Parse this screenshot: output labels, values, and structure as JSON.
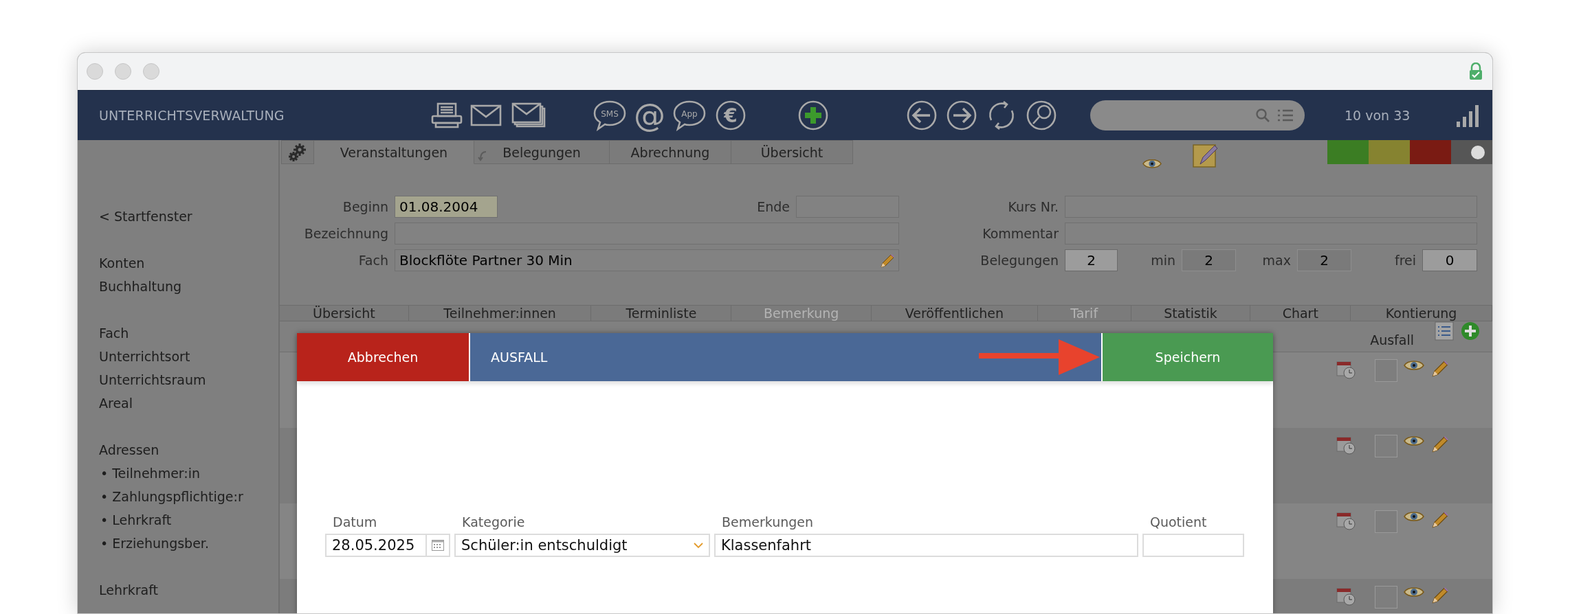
{
  "window": {
    "title": "UNTERRICHTSVERWALTUNG",
    "record_counter": "10 von 33"
  },
  "toolbar": [
    {
      "kind": "printer"
    },
    {
      "kind": "mail"
    },
    {
      "kind": "mail-stack"
    },
    {
      "kind": "bubble",
      "glyph": "SMS"
    },
    {
      "kind": "glyph",
      "glyph": "@"
    },
    {
      "kind": "bubble",
      "glyph": "App"
    },
    {
      "kind": "ring-glyph",
      "glyph": "€"
    },
    {
      "kind": "add"
    },
    {
      "kind": "back"
    },
    {
      "kind": "forward"
    },
    {
      "kind": "refresh"
    },
    {
      "kind": "search"
    }
  ],
  "sidebar": {
    "groups": [
      {
        "items": [
          {
            "label": "< Startfenster"
          }
        ]
      },
      {
        "items": [
          {
            "label": "Konten"
          },
          {
            "label": "Buchhaltung"
          }
        ]
      },
      {
        "items": [
          {
            "label": "Fach"
          },
          {
            "label": "Unterrichtsort"
          },
          {
            "label": "Unterrichtsraum"
          },
          {
            "label": "Areal"
          }
        ]
      },
      {
        "items": [
          {
            "label": "Adressen",
            "children": [
              {
                "label": "• Teilnehmer:in"
              },
              {
                "label": "• Zahlungspflichtige:r"
              },
              {
                "label": "• Lehrkraft"
              },
              {
                "label": "• Erziehungsber."
              }
            ]
          }
        ]
      },
      {
        "items": [
          {
            "label": "Lehrkraft"
          }
        ]
      }
    ]
  },
  "main_tabs": [
    {
      "label": "Veranstaltungen",
      "selected": true
    },
    {
      "label": "Belegungen",
      "selected": false
    },
    {
      "label": "Abrechnung",
      "selected": false
    },
    {
      "label": "Übersicht",
      "selected": false
    }
  ],
  "status_colors": [
    {
      "color": "#3b7d23",
      "selected": false
    },
    {
      "color": "#868330",
      "selected": false
    },
    {
      "color": "#7a1b13",
      "selected": false
    },
    {
      "color": "#565656",
      "selected": true
    }
  ],
  "form": {
    "beginn": {
      "label": "Beginn",
      "value": "01.08.2004"
    },
    "ende": {
      "label": "Ende"
    },
    "bezeichnung": {
      "label": "Bezeichnung"
    },
    "fach": {
      "label": "Fach",
      "value": "Blockflöte Partner 30 Min"
    },
    "kurs_nr": {
      "label": "Kurs Nr."
    },
    "kommentar": {
      "label": "Kommentar"
    },
    "belegungen": {
      "label": "Belegungen",
      "value": "2",
      "readonly": true
    },
    "min": {
      "label": "min",
      "value": "2",
      "readonly": false
    },
    "max": {
      "label": "max",
      "value": "2",
      "readonly": false
    },
    "frei": {
      "label": "frei",
      "value": "0",
      "readonly": true
    }
  },
  "sub_tabs": [
    {
      "label": "Übersicht",
      "disabled": false
    },
    {
      "label": "Teilnehmer:innen",
      "disabled": false
    },
    {
      "label": "Terminliste",
      "disabled": false
    },
    {
      "label": "Bemerkung",
      "disabled": true
    },
    {
      "label": "Veröffentlichen",
      "disabled": false
    },
    {
      "label": "Tarif",
      "disabled": true
    },
    {
      "label": "Statistik",
      "disabled": false
    },
    {
      "label": "Chart",
      "disabled": false
    },
    {
      "label": "Kontierung",
      "disabled": false
    }
  ],
  "list": {
    "column_header": "Ausfall",
    "rows": [
      {
        "checked": false
      },
      {
        "checked": false
      },
      {
        "checked": false
      },
      {
        "checked": false
      }
    ]
  },
  "dialog": {
    "cancel": "Abbrechen",
    "title": "AUSFALL",
    "save": "Speichern",
    "fields": [
      {
        "label": "Datum",
        "value": "28.05.2025",
        "kind": "date"
      },
      {
        "label": "Kategorie",
        "value": "Schüler:in entschuldigt",
        "kind": "select"
      },
      {
        "label": "Bemerkungen",
        "value": "Klassenfahrt",
        "kind": "text"
      },
      {
        "label": "Quotient",
        "kind": "text"
      }
    ]
  }
}
